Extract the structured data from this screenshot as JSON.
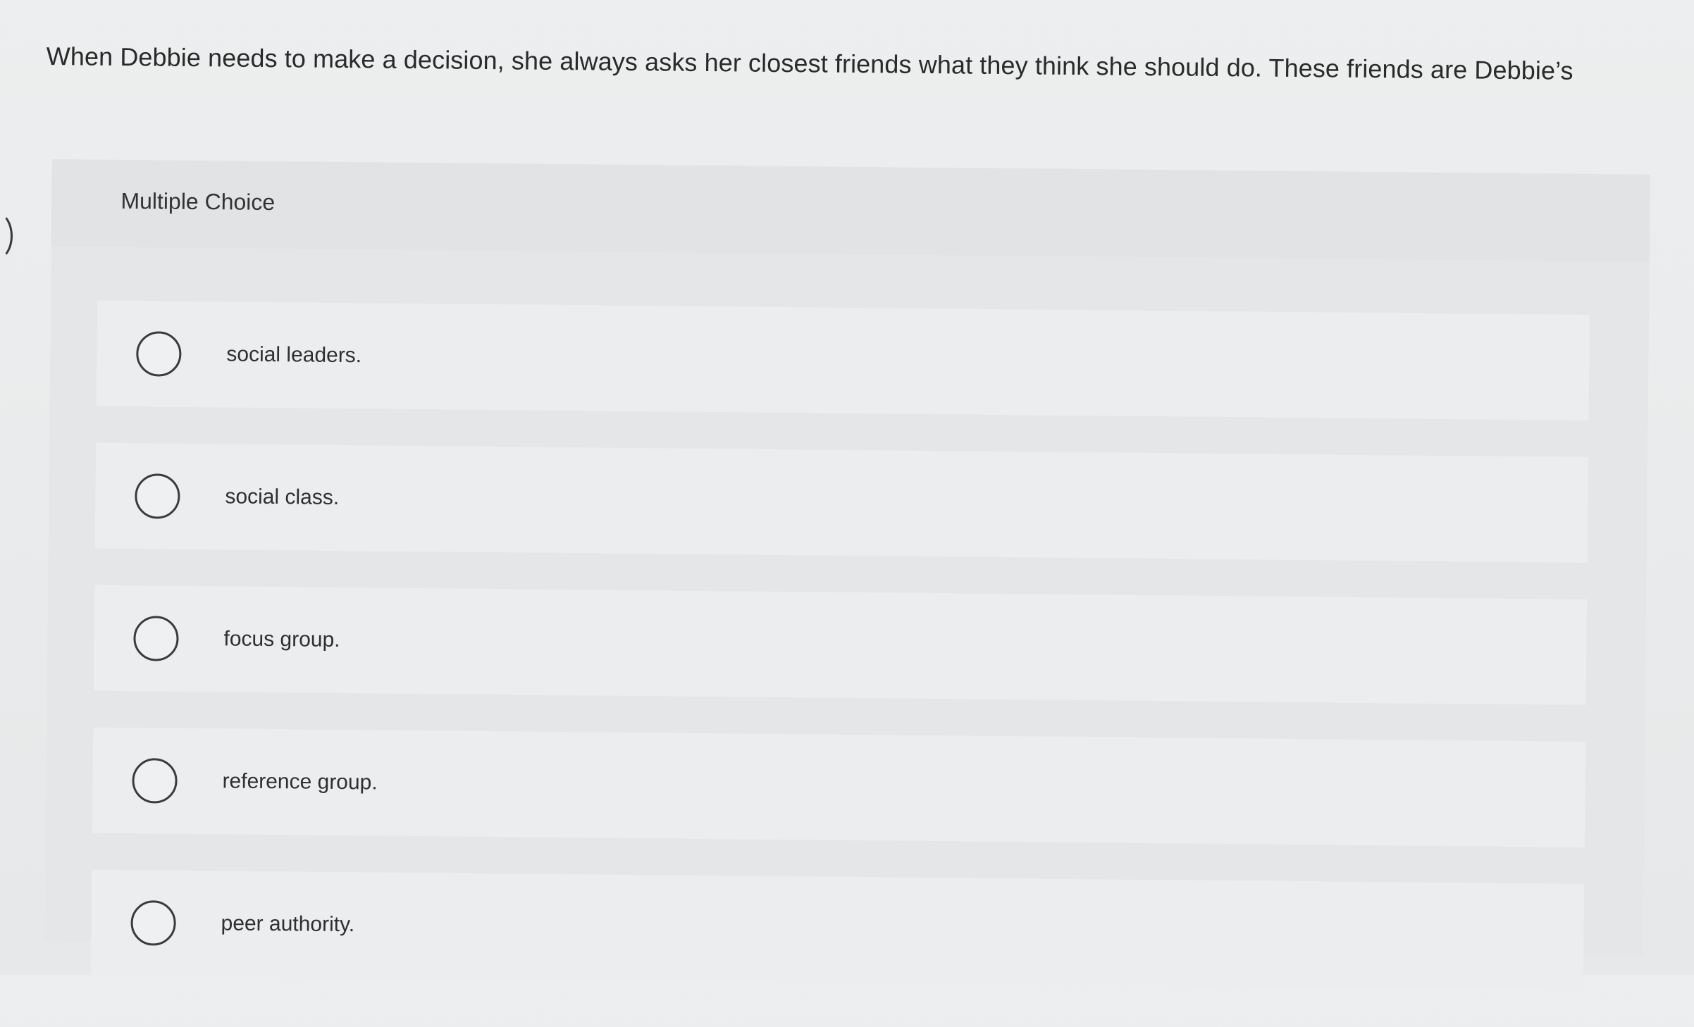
{
  "question": {
    "text": "When Debbie needs to make a decision, she always asks her closest friends what they think she should do. These friends are Debbie’s"
  },
  "multiple_choice": {
    "label": "Multiple Choice",
    "options": [
      {
        "label": "social leaders."
      },
      {
        "label": "social class."
      },
      {
        "label": "focus group."
      },
      {
        "label": "reference group."
      },
      {
        "label": "peer authority."
      }
    ]
  },
  "icons": {
    "radio": "radio-circle-icon"
  },
  "colors": {
    "background": "#eceeef",
    "panel": "#e4e6e7",
    "option_row": "#ebedee",
    "text": "#2a2a2a",
    "radio_border": "#3b3b3b"
  }
}
